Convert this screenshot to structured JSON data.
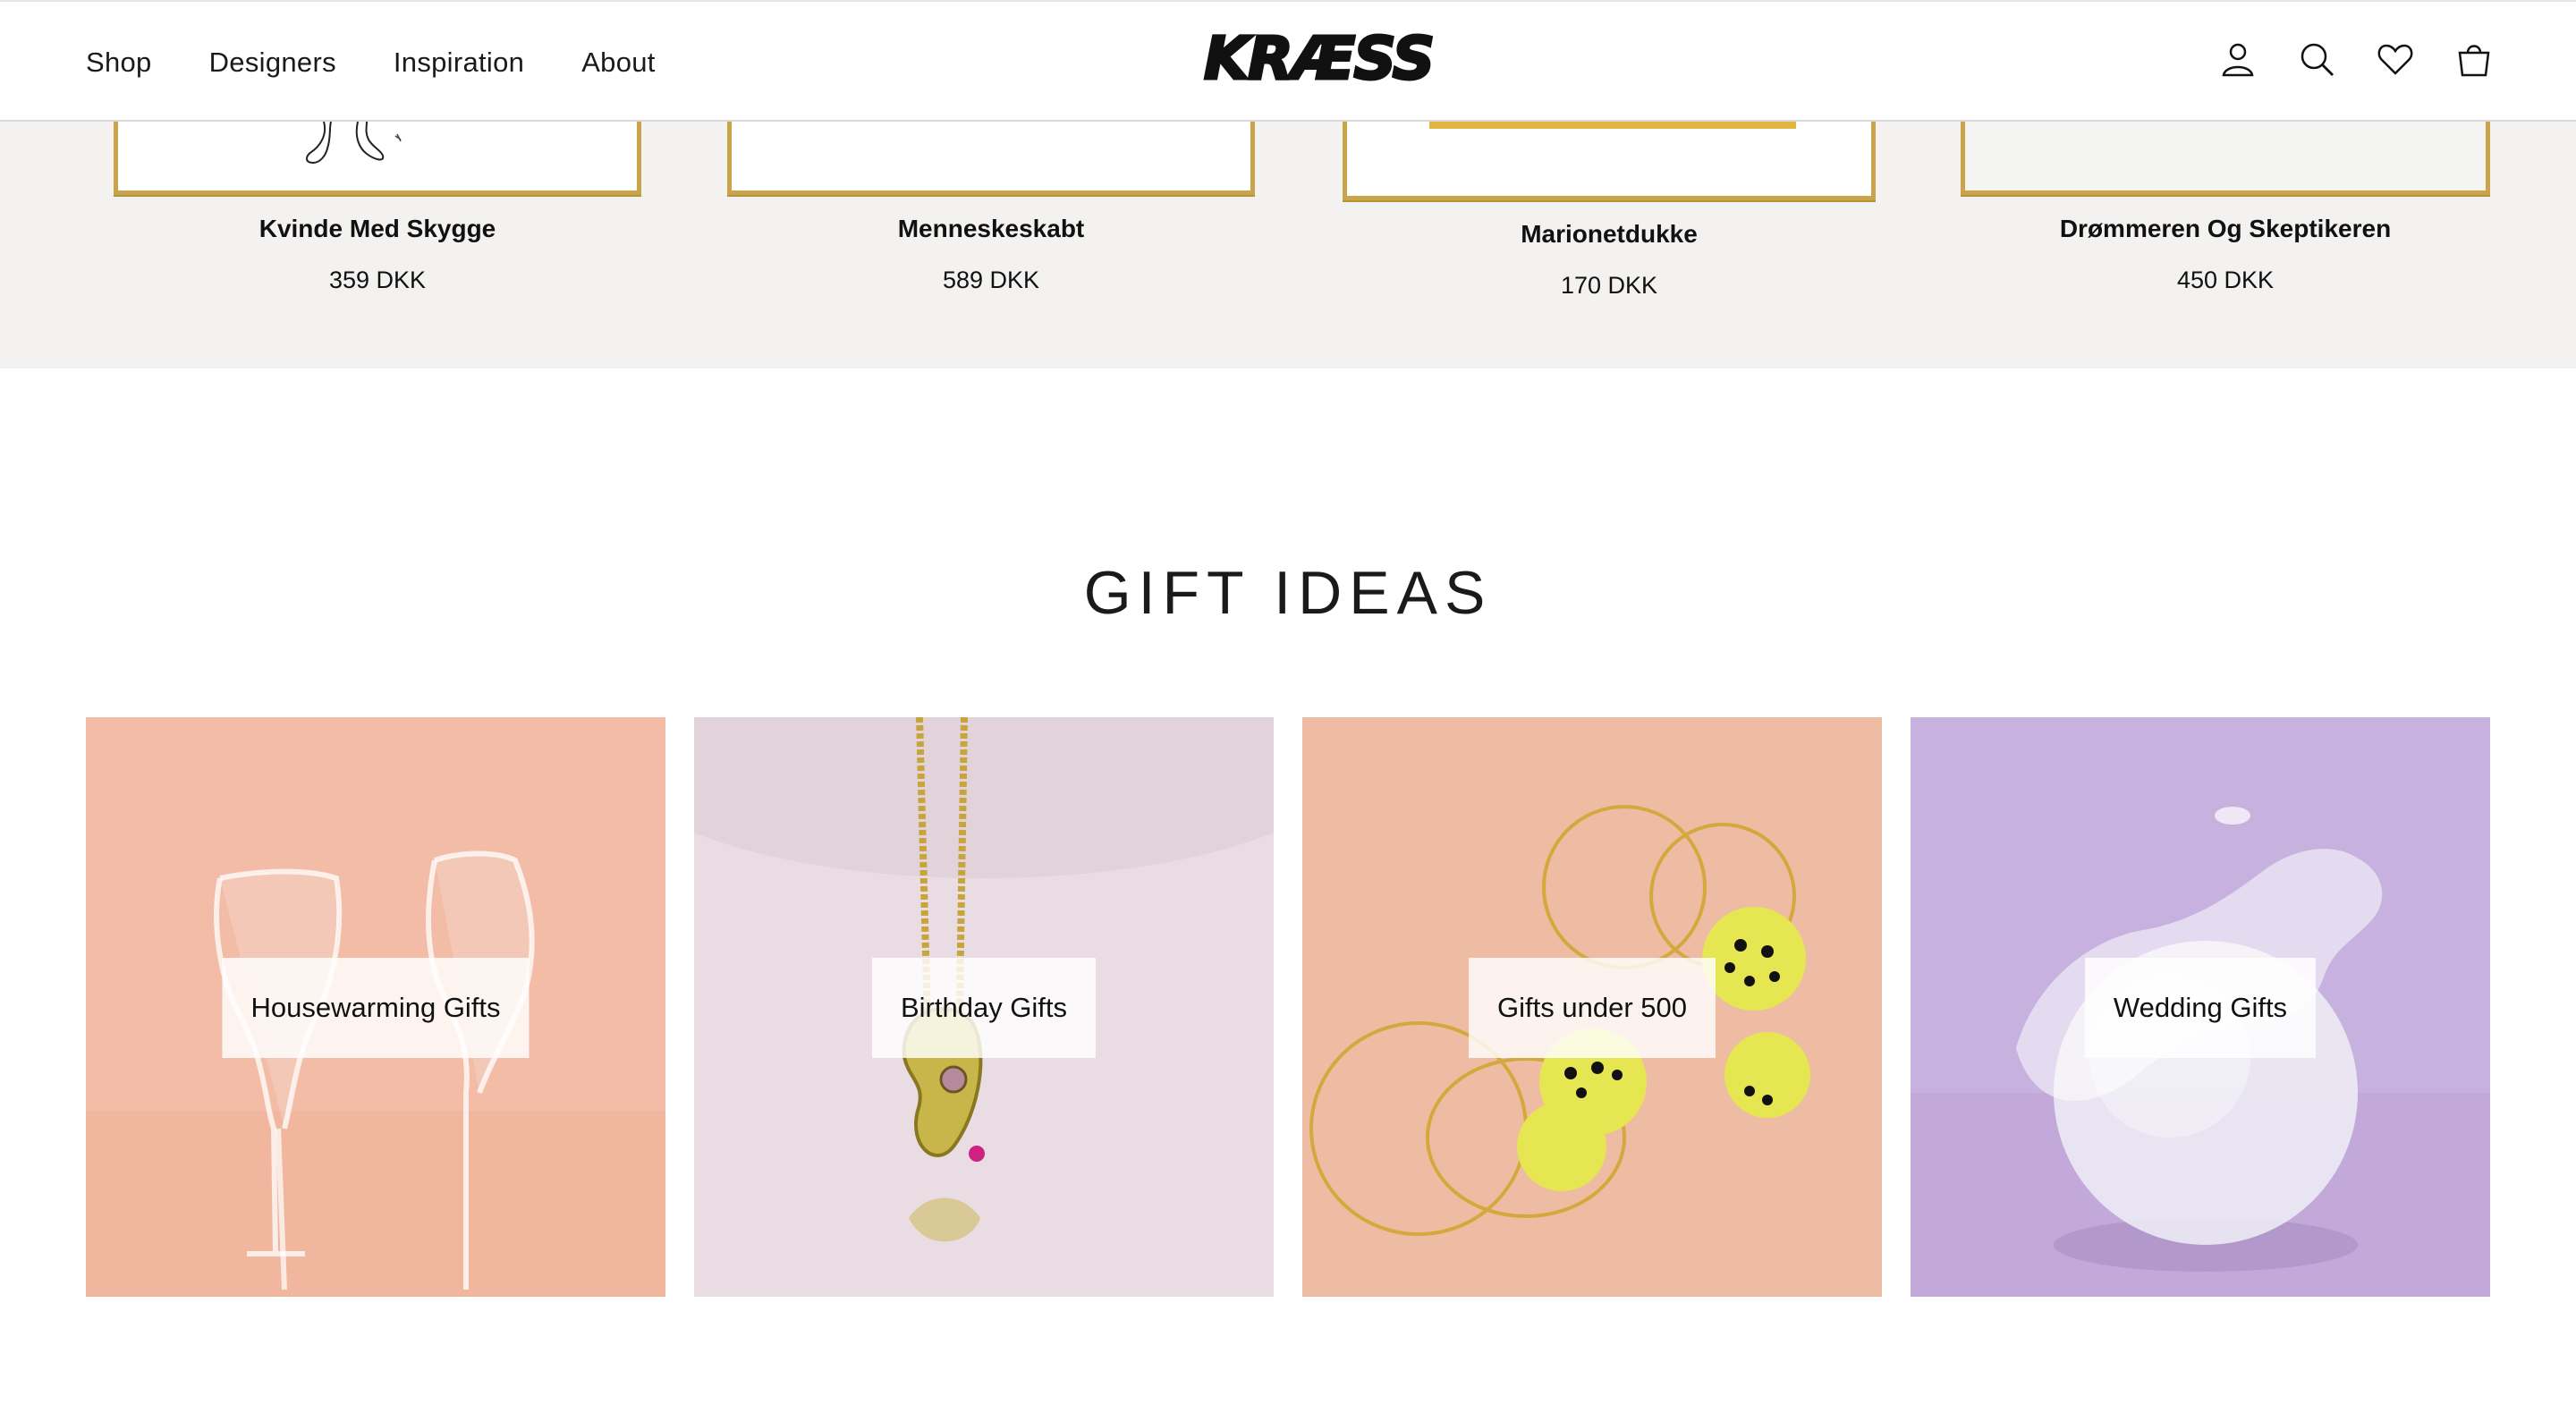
{
  "header": {
    "nav": [
      "Shop",
      "Designers",
      "Inspiration",
      "About"
    ],
    "logo_text": "KRÆSS",
    "icons": [
      "account-icon",
      "search-icon",
      "wishlist-heart-icon",
      "shopping-bag-icon"
    ]
  },
  "products": [
    {
      "name": "Kvinde Med Skygge",
      "price": "359 DKK"
    },
    {
      "name": "Menneskeskabt",
      "price": "589 DKK"
    },
    {
      "name": "Marionetdukke",
      "price": "170 DKK"
    },
    {
      "name": "Drømmeren Og Skeptikeren",
      "price": "450 DKK"
    }
  ],
  "gift_ideas": {
    "title": "GIFT IDEAS",
    "tiles": [
      {
        "label": "Housewarming Gifts",
        "bg": "#f2bca6"
      },
      {
        "label": "Birthday Gifts",
        "bg": "#e9dde3"
      },
      {
        "label": "Gifts under 500",
        "bg": "#eebca2"
      },
      {
        "label": "Wedding Gifts",
        "bg": "#c7b1de"
      }
    ]
  },
  "colors": {
    "frame_gold": "#c9a44a",
    "strip_bg": "#f3f2f0"
  }
}
